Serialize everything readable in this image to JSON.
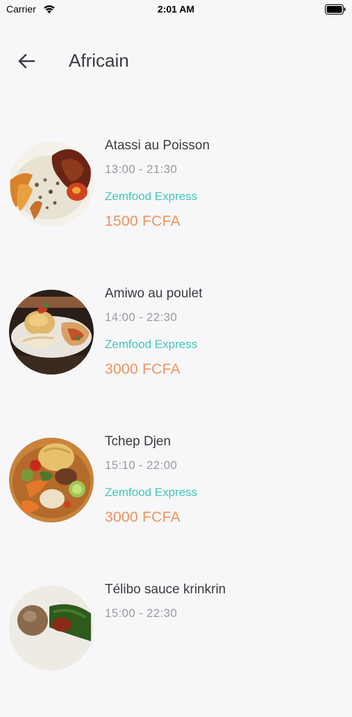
{
  "status_bar": {
    "carrier": "Carrier",
    "time": "2:01 AM"
  },
  "header": {
    "title": "Africain",
    "back_icon": "arrow-left-icon"
  },
  "items": [
    {
      "name": "Atassi au Poisson",
      "hours": "13:00 - 21:30",
      "restaurant": "Zemfood Express",
      "price": "1500 FCFA"
    },
    {
      "name": "Amiwo au poulet",
      "hours": "14:00 - 22:30",
      "restaurant": "Zemfood Express",
      "price": "3000 FCFA"
    },
    {
      "name": "Tchep Djen",
      "hours": "15:10 - 22:00",
      "restaurant": "Zemfood Express",
      "price": "3000 FCFA"
    },
    {
      "name": "Télibo sauce krinkrin",
      "hours": "15:00 - 22:30",
      "restaurant": "",
      "price": ""
    }
  ],
  "colors": {
    "accent_teal": "#45c6b9",
    "price_orange": "#f0925a",
    "background": "#f7f7f9"
  }
}
